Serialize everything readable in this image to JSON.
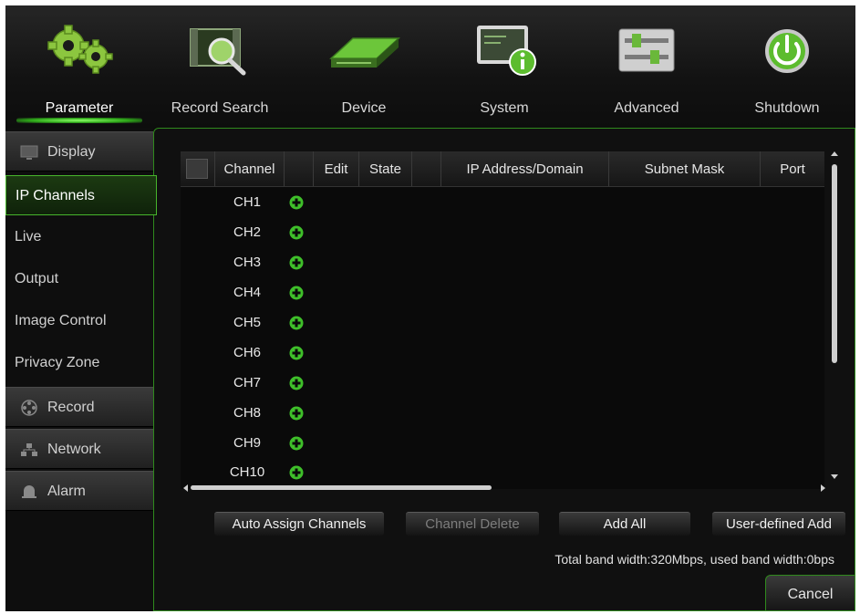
{
  "toolbar": {
    "items": [
      {
        "label": "Parameter",
        "icon": "gears-icon"
      },
      {
        "label": "Record Search",
        "icon": "film-search-icon"
      },
      {
        "label": "Device",
        "icon": "hard-drive-icon"
      },
      {
        "label": "System",
        "icon": "monitor-info-icon"
      },
      {
        "label": "Advanced",
        "icon": "sliders-icon"
      },
      {
        "label": "Shutdown",
        "icon": "power-icon"
      }
    ],
    "active": "Parameter"
  },
  "sidebar": {
    "items": [
      {
        "label": "Display",
        "type": "section"
      },
      {
        "label": "IP Channels",
        "type": "item",
        "active": true
      },
      {
        "label": "Live",
        "type": "item"
      },
      {
        "label": "Output",
        "type": "item"
      },
      {
        "label": "Image Control",
        "type": "item"
      },
      {
        "label": "Privacy Zone",
        "type": "item"
      },
      {
        "label": "Record",
        "type": "section"
      },
      {
        "label": "Network",
        "type": "section"
      },
      {
        "label": "Alarm",
        "type": "section"
      }
    ]
  },
  "table": {
    "columns": [
      "Channel",
      "Edit",
      "State",
      "IP Address/Domain",
      "Subnet Mask",
      "Port"
    ],
    "rows": [
      "CH1",
      "CH2",
      "CH3",
      "CH4",
      "CH5",
      "CH6",
      "CH7",
      "CH8",
      "CH9",
      "CH10"
    ]
  },
  "actions": {
    "auto_assign": "Auto Assign Channels",
    "channel_delete": "Channel Delete",
    "add_all": "Add All",
    "user_defined_add": "User-defined Add"
  },
  "bandwidth": "Total band width:320Mbps, used band width:0bps",
  "cancel": "Cancel",
  "colors": {
    "accent": "#3fbf2a",
    "background": "#0c0c0c",
    "text": "#e0e0e0"
  }
}
